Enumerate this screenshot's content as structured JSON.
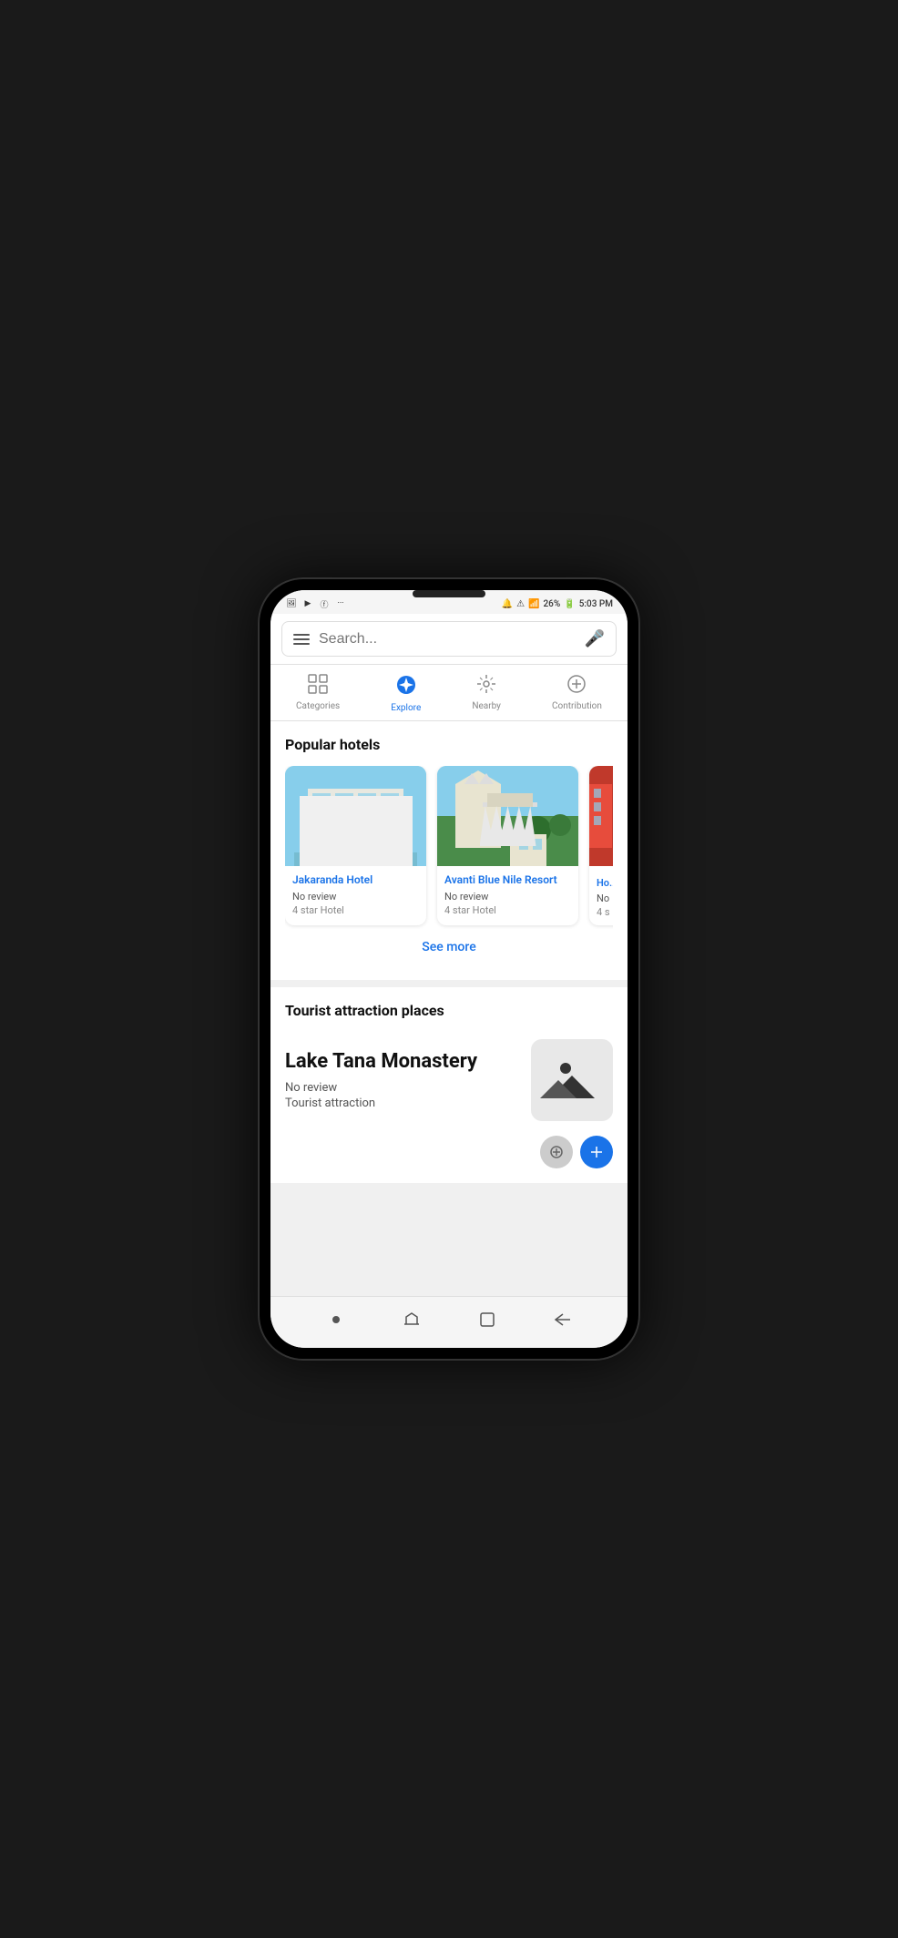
{
  "phone": {
    "status_bar": {
      "time": "5:03 PM",
      "battery": "26%",
      "signal": "4 bars"
    },
    "search": {
      "placeholder": "Search...",
      "mic_label": "microphone"
    },
    "nav_tabs": [
      {
        "id": "categories",
        "label": "Categories",
        "icon": "⊞",
        "active": false
      },
      {
        "id": "explore",
        "label": "Explore",
        "icon": "🧭",
        "active": true
      },
      {
        "id": "nearby",
        "label": "Nearby",
        "icon": "📡",
        "active": false
      },
      {
        "id": "contribution",
        "label": "Contribution",
        "icon": "⊕",
        "active": false
      }
    ],
    "sections": {
      "hotels": {
        "title": "Popular hotels",
        "see_more": "See more",
        "items": [
          {
            "name": "Jakaranda Hotel",
            "review": "No  review",
            "stars": "4 star Hotel"
          },
          {
            "name": "Avanti Blue Nile Resort",
            "review": "No  review",
            "stars": "4 star Hotel"
          },
          {
            "name": "Ho...",
            "review": "No",
            "stars": "4 s"
          }
        ]
      },
      "tourist": {
        "title": "Tourist attraction places",
        "items": [
          {
            "name": "Lake Tana Monastery",
            "review": "No  review",
            "type": "Tourist attraction"
          }
        ]
      }
    },
    "bottom_nav": {
      "dot": "●",
      "back": "↵",
      "square": "□",
      "arrow": "←"
    }
  }
}
